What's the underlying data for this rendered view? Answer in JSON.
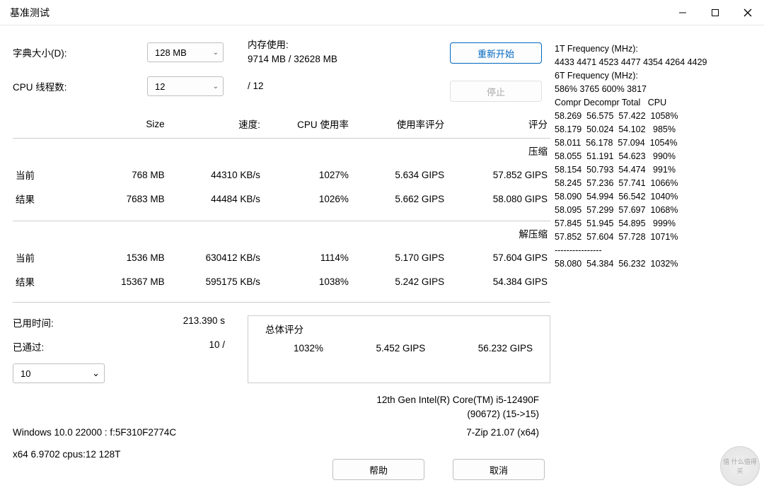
{
  "window": {
    "title": "基准测试"
  },
  "controls": {
    "dict_label": "字典大小(D):",
    "dict_value": "128 MB",
    "threads_label": "CPU 线程数:",
    "threads_value": "12",
    "threads_total": "/ 12",
    "mem_label": "内存使用:",
    "mem_value": "9714 MB / 32628 MB",
    "restart": "重新开始",
    "stop": "停止"
  },
  "table": {
    "headers": {
      "size": "Size",
      "speed": "速度:",
      "cpu": "CPU 使用率",
      "rating": "使用率评分",
      "total": "评分"
    },
    "compress": {
      "label": "压缩",
      "current_label": "当前",
      "current": {
        "size": "768 MB",
        "speed": "44310 KB/s",
        "cpu": "1027%",
        "rating": "5.634 GIPS",
        "total": "57.852 GIPS"
      },
      "result_label": "结果",
      "result": {
        "size": "7683 MB",
        "speed": "44484 KB/s",
        "cpu": "1026%",
        "rating": "5.662 GIPS",
        "total": "58.080 GIPS"
      }
    },
    "decompress": {
      "label": "解压缩",
      "current_label": "当前",
      "current": {
        "size": "1536 MB",
        "speed": "630412 KB/s",
        "cpu": "1114%",
        "rating": "5.170 GIPS",
        "total": "57.604 GIPS"
      },
      "result_label": "结果",
      "result": {
        "size": "15367 MB",
        "speed": "595175 KB/s",
        "cpu": "1038%",
        "rating": "5.242 GIPS",
        "total": "54.384 GIPS"
      }
    }
  },
  "elapsed": {
    "time_label": "已用时间:",
    "time_value": "213.390 s",
    "passes_label": "已通过:",
    "passes_value": "10 /",
    "limit": "10"
  },
  "overall": {
    "label": "总体评分",
    "cpu": "1032%",
    "rating": "5.452 GIPS",
    "total": "56.232 GIPS"
  },
  "cpu_info": {
    "line1": "12th Gen Intel(R) Core(TM) i5-12490F",
    "line2": "(90672) (15->15)"
  },
  "sys": {
    "os": "Windows 10.0 22000 :  f:5F310F2774C",
    "app": "7-Zip 21.07 (x64)",
    "arch": "x64 6.9702 cpus:12 128T"
  },
  "footer": {
    "help": "帮助",
    "cancel": "取消"
  },
  "freq": {
    "t1_label": "1T Frequency (MHz):",
    "t1_val": " 4433 4471 4523 4477 4354 4264 4429",
    "t6_label": "6T Frequency (MHz):",
    "t6_val": " 586% 3765 600% 3817",
    "header": "Compr Decompr Total   CPU",
    "rows": [
      "58.269  56.575  57.422  1058%",
      "58.179  50.024  54.102   985%",
      "58.011  56.178  57.094  1054%",
      "58.055  51.191  54.623   990%",
      "58.154  50.793  54.474   991%",
      "58.245  57.236  57.741  1066%",
      "58.090  54.994  56.542  1040%",
      "58.095  57.299  57.697  1068%",
      "57.845  51.945  54.895   999%",
      "57.852  57.604  57.728  1071%"
    ],
    "sep": "----------------",
    "summary": "58.080  54.384  56.232  1032%"
  },
  "watermark": "值 什么值得买"
}
